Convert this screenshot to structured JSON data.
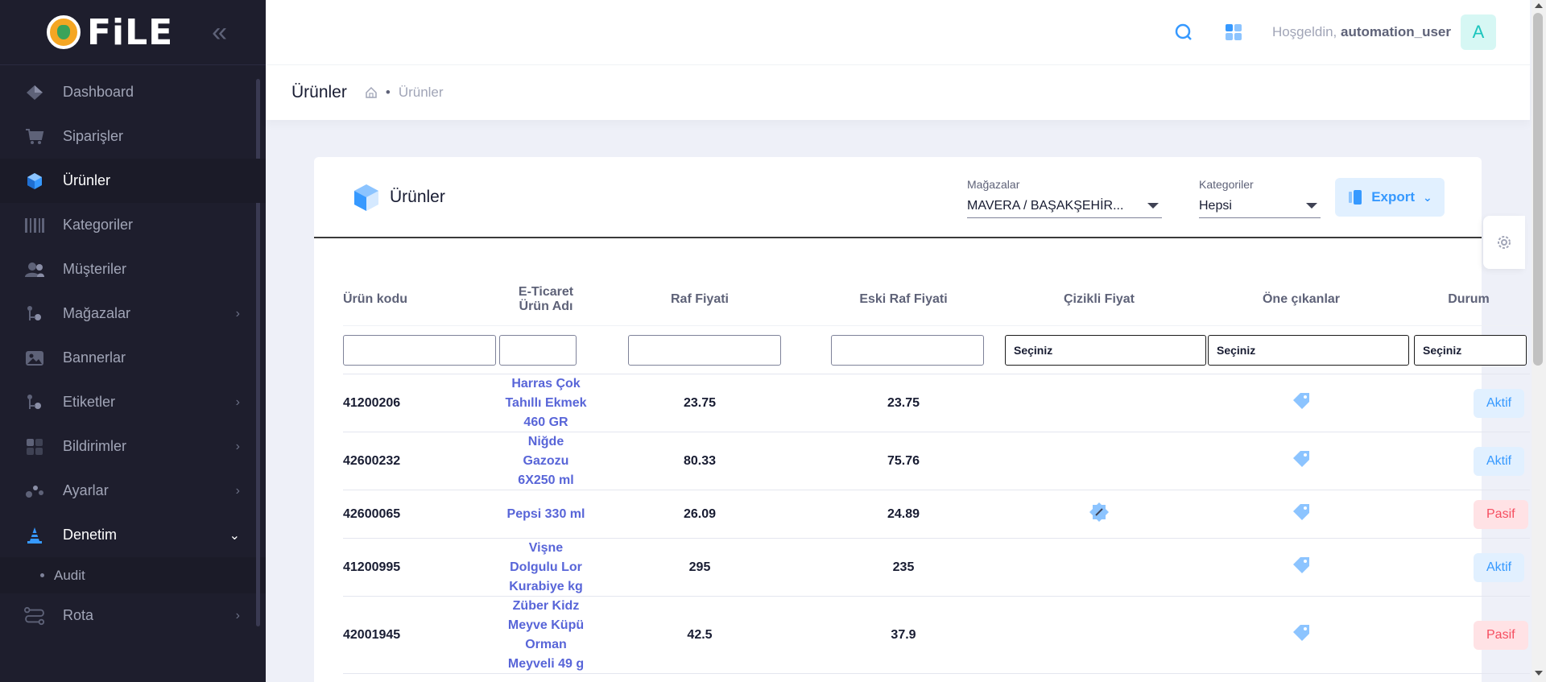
{
  "app": {
    "logo_text": "FiLE"
  },
  "sidebar": {
    "items": [
      {
        "label": "Dashboard",
        "icon": "dashboard-icon"
      },
      {
        "label": "Siparişler",
        "icon": "cart-icon"
      },
      {
        "label": "Ürünler",
        "icon": "cube-icon",
        "active": true
      },
      {
        "label": "Kategoriler",
        "icon": "barcode-icon"
      },
      {
        "label": "Müşteriler",
        "icon": "users-icon"
      },
      {
        "label": "Mağazalar",
        "icon": "store-icon",
        "expandable": true
      },
      {
        "label": "Bannerlar",
        "icon": "image-icon"
      },
      {
        "label": "Etiketler",
        "icon": "tag-icon",
        "expandable": true
      },
      {
        "label": "Bildirimler",
        "icon": "bell-icon",
        "expandable": true
      },
      {
        "label": "Ayarlar",
        "icon": "settings-icon",
        "expandable": true
      },
      {
        "label": "Denetim",
        "icon": "cone-icon",
        "open": true
      },
      {
        "label": "Rota",
        "icon": "route-icon",
        "expandable": true
      }
    ],
    "subitems": {
      "audit": "Audit"
    }
  },
  "header": {
    "welcome_prefix": "Hoşgeldin,",
    "username": "automation_user",
    "avatar_letter": "A"
  },
  "toolbar": {
    "title": "Ürünler",
    "breadcrumb_current": "Ürünler"
  },
  "card": {
    "title": "Ürünler",
    "stores_label": "Mağazalar",
    "stores_value": "MAVERA / BAŞAKŞEHİR...",
    "categories_label": "Kategoriler",
    "categories_value": "Hepsi",
    "export_label": "Export"
  },
  "table": {
    "headers": {
      "code": "Ürün kodu",
      "name_line1": "E-Ticaret",
      "name_line2": "Ürün Adı",
      "price": "Raf Fiyati",
      "old_price": "Eski Raf Fiyati",
      "strike": "Çizikli Fiyat",
      "featured": "Öne çıkanlar",
      "status": "Durum"
    },
    "filter_placeholder": "Seçiniz",
    "rows": [
      {
        "code": "41200206",
        "name": [
          "Harras Çok",
          "Tahıllı Ekmek",
          "460 GR"
        ],
        "price": "23.75",
        "old_price": "23.75",
        "strike": false,
        "status": "Aktif",
        "active": true
      },
      {
        "code": "42600232",
        "name": [
          "Niğde",
          "Gazozu",
          "6X250 ml"
        ],
        "price": "80.33",
        "old_price": "75.76",
        "strike": false,
        "status": "Aktif",
        "active": true
      },
      {
        "code": "42600065",
        "name": [
          "Pepsi 330 ml"
        ],
        "price": "26.09",
        "old_price": "24.89",
        "strike": true,
        "status": "Pasif",
        "active": false
      },
      {
        "code": "41200995",
        "name": [
          "Vişne",
          "Dolgulu Lor",
          "Kurabiye kg"
        ],
        "price": "295",
        "old_price": "235",
        "strike": false,
        "status": "Aktif",
        "active": true
      },
      {
        "code": "42001945",
        "name": [
          "Züber Kidz",
          "Meyve Küpü",
          "Orman",
          "Meyveli 49 g"
        ],
        "price": "42.5",
        "old_price": "37.9",
        "strike": false,
        "status": "Pasif",
        "active": false
      }
    ]
  },
  "colors": {
    "primary": "#3699ff",
    "sidebar_bg": "#1e1e2d",
    "danger": "#f64e60"
  }
}
